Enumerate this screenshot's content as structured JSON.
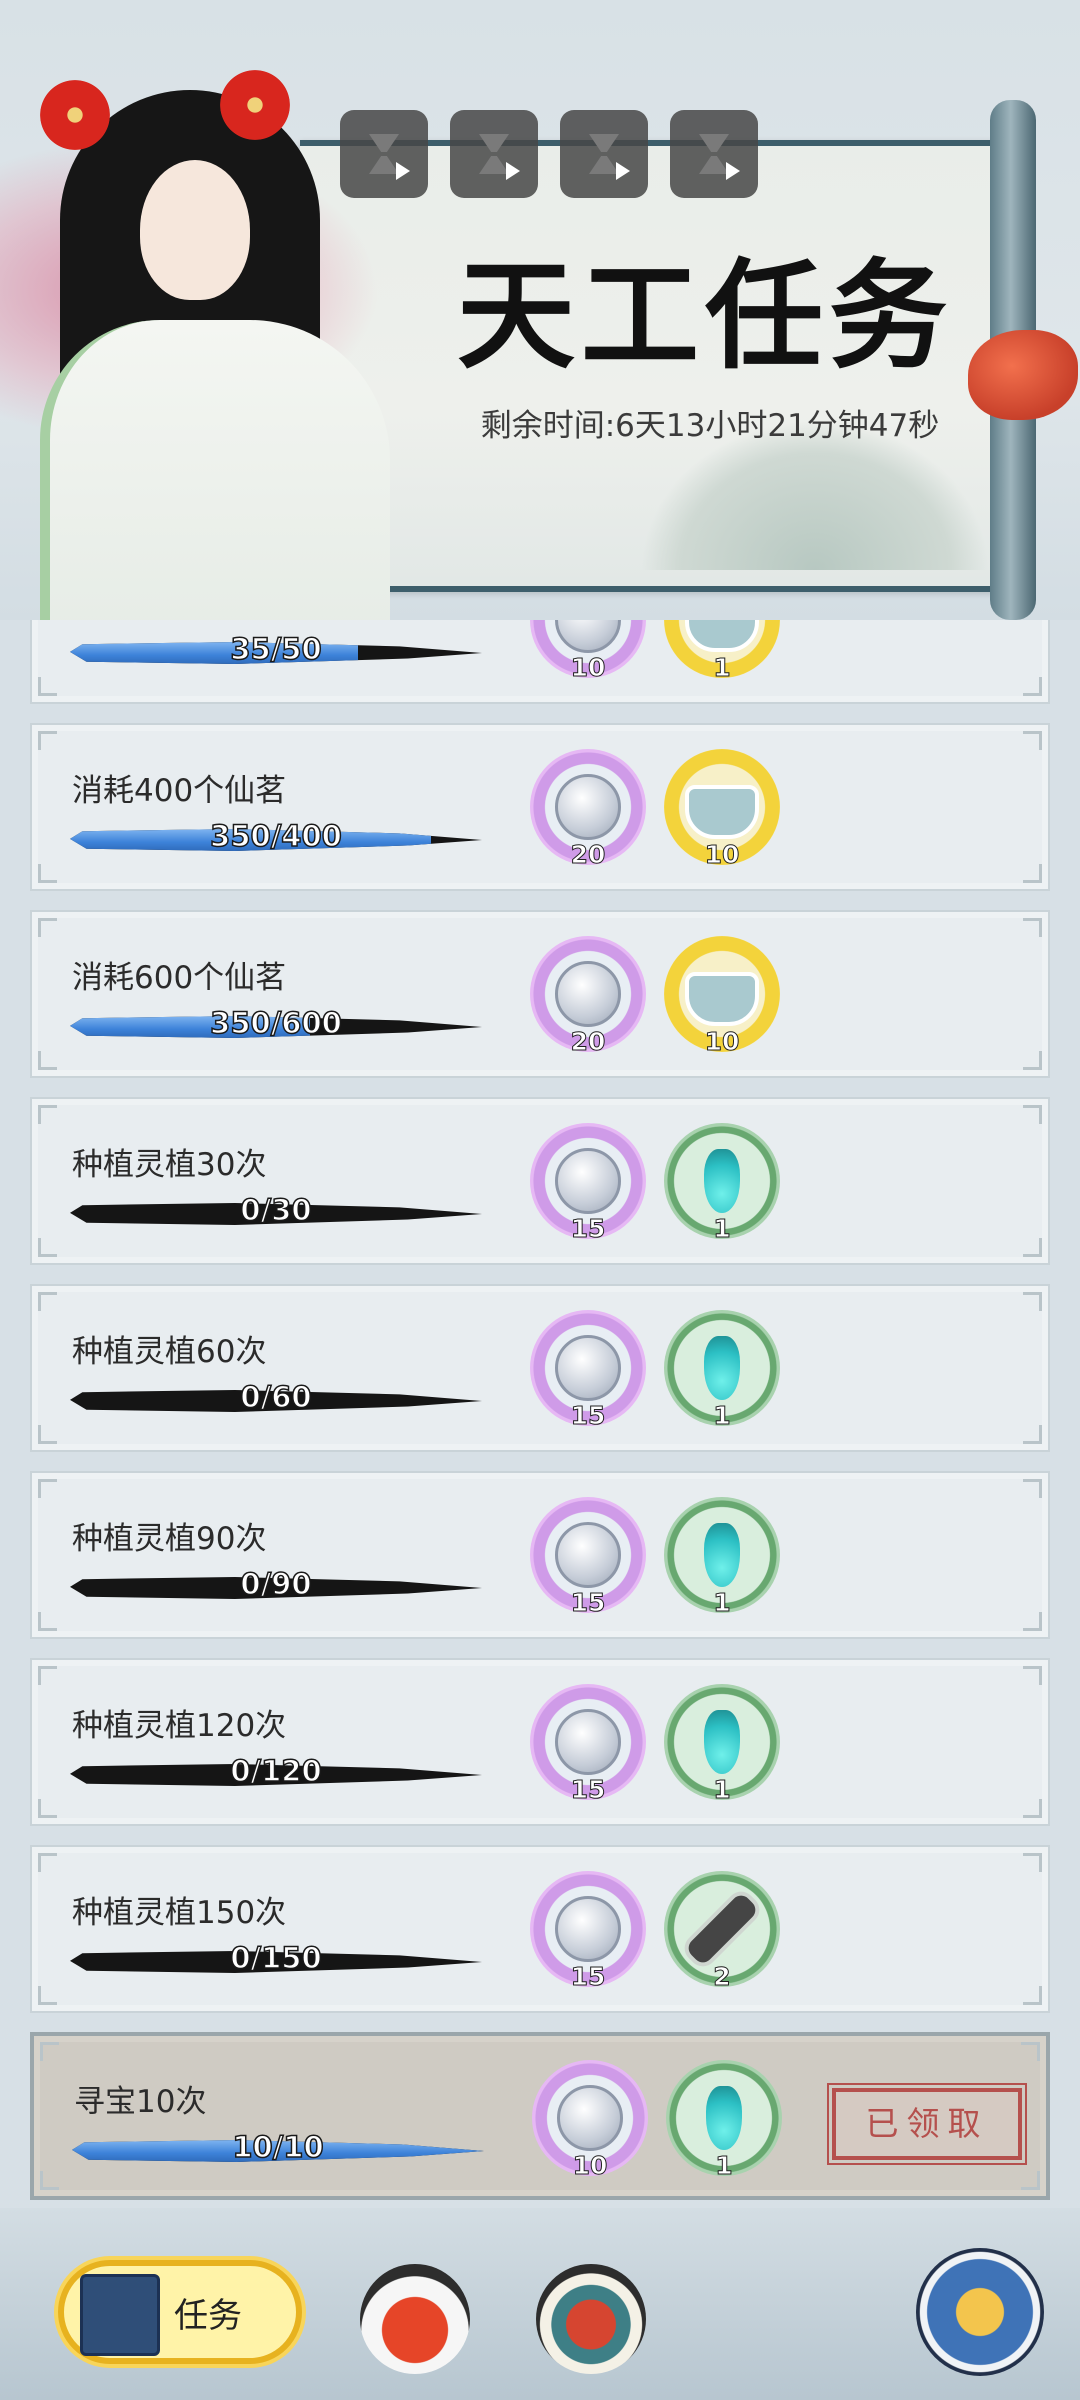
{
  "header": {
    "title": "天工任务",
    "time_left": "剩余时间:6天13小时21分钟47秒",
    "video_buttons": [
      "video-ad-1",
      "video-ad-2",
      "video-ad-3",
      "video-ad-4"
    ]
  },
  "tasks": [
    {
      "name": "",
      "progress_text": "35/50",
      "progress": 0.7,
      "rewards": [
        {
          "icon": "spirit-stone-icon",
          "count": "10",
          "rarity": "purple"
        },
        {
          "icon": "tea-leaf-icon",
          "count": "1",
          "rarity": "gold"
        }
      ],
      "status": "in-progress"
    },
    {
      "name": "消耗400个仙茗",
      "progress_text": "350/400",
      "progress": 0.875,
      "rewards": [
        {
          "icon": "spirit-stone-icon",
          "count": "20",
          "rarity": "purple"
        },
        {
          "icon": "tea-bowl-icon",
          "count": "10",
          "rarity": "gold"
        }
      ],
      "status": "in-progress"
    },
    {
      "name": "消耗600个仙茗",
      "progress_text": "350/600",
      "progress": 0.583,
      "rewards": [
        {
          "icon": "spirit-stone-icon",
          "count": "20",
          "rarity": "purple"
        },
        {
          "icon": "tea-bowl-icon",
          "count": "10",
          "rarity": "gold"
        }
      ],
      "status": "in-progress"
    },
    {
      "name": "种植灵植30次",
      "progress_text": "0/30",
      "progress": 0,
      "rewards": [
        {
          "icon": "spirit-stone-icon",
          "count": "15",
          "rarity": "purple"
        },
        {
          "icon": "elixir-vial-icon",
          "count": "1",
          "rarity": "green"
        }
      ],
      "status": "in-progress"
    },
    {
      "name": "种植灵植60次",
      "progress_text": "0/60",
      "progress": 0,
      "rewards": [
        {
          "icon": "spirit-stone-icon",
          "count": "15",
          "rarity": "purple"
        },
        {
          "icon": "elixir-vial-icon",
          "count": "1",
          "rarity": "green"
        }
      ],
      "status": "in-progress"
    },
    {
      "name": "种植灵植90次",
      "progress_text": "0/90",
      "progress": 0,
      "rewards": [
        {
          "icon": "spirit-stone-icon",
          "count": "15",
          "rarity": "purple"
        },
        {
          "icon": "elixir-vial-icon",
          "count": "1",
          "rarity": "green"
        }
      ],
      "status": "in-progress"
    },
    {
      "name": "种植灵植120次",
      "progress_text": "0/120",
      "progress": 0,
      "rewards": [
        {
          "icon": "spirit-stone-icon",
          "count": "15",
          "rarity": "purple"
        },
        {
          "icon": "elixir-vial-icon",
          "count": "1",
          "rarity": "green"
        }
      ],
      "status": "in-progress"
    },
    {
      "name": "种植灵植150次",
      "progress_text": "0/150",
      "progress": 0,
      "rewards": [
        {
          "icon": "spirit-stone-icon",
          "count": "15",
          "rarity": "purple"
        },
        {
          "icon": "scroll-icon",
          "count": "2",
          "rarity": "green"
        }
      ],
      "status": "in-progress"
    },
    {
      "name": "寻宝10次",
      "progress_text": "10/10",
      "progress": 1,
      "rewards": [
        {
          "icon": "spirit-stone-icon",
          "count": "10",
          "rarity": "purple"
        },
        {
          "icon": "elixir-vial-icon",
          "count": "1",
          "rarity": "green"
        }
      ],
      "status": "claimed",
      "stamp": "已领取"
    }
  ],
  "bottom_nav": {
    "tasks_label": "任务",
    "items": [
      "task-book-icon",
      "lucky-bag-icon",
      "temple-icon",
      "swirl-return-icon"
    ]
  }
}
